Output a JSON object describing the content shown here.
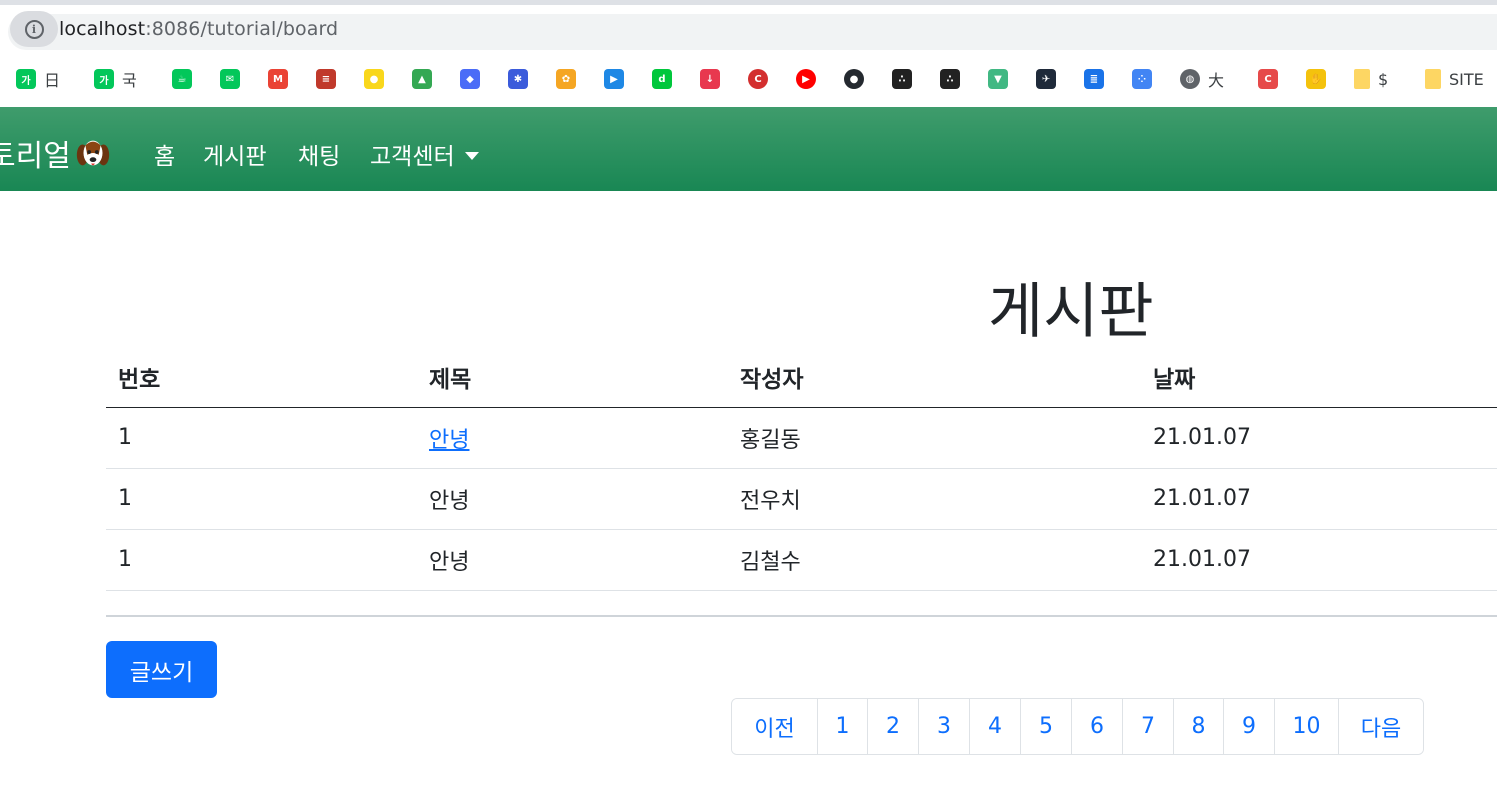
{
  "browser": {
    "url_host": "localhost",
    "url_path": ":8086/tutorial/board",
    "bookmarks": [
      {
        "icon": "naver-dictionary-icon",
        "glyph": "가",
        "color": "#03c75a",
        "label": "日"
      },
      {
        "icon": "naver-dictionary-icon",
        "glyph": "가",
        "color": "#03c75a",
        "label": "국"
      },
      {
        "icon": "naver-cafe-icon",
        "glyph": "☕",
        "color": "#03c75a",
        "label": ""
      },
      {
        "icon": "naver-mail-icon",
        "glyph": "✉",
        "color": "#03c75a",
        "label": ""
      },
      {
        "icon": "gmail-icon",
        "glyph": "M",
        "color": "#ea4335",
        "label": ""
      },
      {
        "icon": "rainbow-icon",
        "glyph": "≡",
        "color": "#c0392b",
        "label": ""
      },
      {
        "icon": "map-pin-icon",
        "glyph": "●",
        "color": "#f9d71c",
        "label": ""
      },
      {
        "icon": "google-drive-icon",
        "glyph": "▲",
        "color": "#34a853",
        "label": ""
      },
      {
        "icon": "cube-icon",
        "glyph": "◆",
        "color": "#4a6cf7",
        "label": ""
      },
      {
        "icon": "tool-icon",
        "glyph": "✱",
        "color": "#3b5bdb",
        "label": ""
      },
      {
        "icon": "gift-icon",
        "glyph": "✿",
        "color": "#f5a623",
        "label": ""
      },
      {
        "icon": "play-icon",
        "glyph": "▶",
        "color": "#1e88e5",
        "label": ""
      },
      {
        "icon": "d-icon",
        "glyph": "d",
        "color": "#00c73c",
        "label": ""
      },
      {
        "icon": "download-icon",
        "glyph": "↓",
        "color": "#e8384f",
        "label": ""
      },
      {
        "icon": "c-badge-icon",
        "glyph": "C",
        "color": "#d32f2f",
        "label": ""
      },
      {
        "icon": "youtube-icon",
        "glyph": "▶",
        "color": "#ff0000",
        "label": ""
      },
      {
        "icon": "github-icon",
        "glyph": "●",
        "color": "#24292f",
        "label": ""
      },
      {
        "icon": "dots-icon",
        "glyph": "∴",
        "color": "#222222",
        "label": ""
      },
      {
        "icon": "dots-icon",
        "glyph": "∴",
        "color": "#222222",
        "label": ""
      },
      {
        "icon": "vue-icon",
        "glyph": "▼",
        "color": "#41b883",
        "label": ""
      },
      {
        "icon": "bird-icon",
        "glyph": "✈",
        "color": "#1f2a3a",
        "label": ""
      },
      {
        "icon": "list-icon",
        "glyph": "≣",
        "color": "#1a73e8",
        "label": ""
      },
      {
        "icon": "apps-icon",
        "glyph": "⁘",
        "color": "#4285f4",
        "label": ""
      },
      {
        "icon": "globe-icon",
        "glyph": "◍",
        "color": "#5f6368",
        "label": "大"
      },
      {
        "icon": "c-square-icon",
        "glyph": "C",
        "color": "#e64a4a",
        "label": ""
      },
      {
        "icon": "hand-icon",
        "glyph": "✋",
        "color": "#f4c20d",
        "label": ""
      },
      {
        "icon": "folder-icon",
        "glyph": "",
        "color": "#fdd663",
        "label": "$"
      },
      {
        "icon": "folder-icon",
        "glyph": "",
        "color": "#fdd663",
        "label": "SITE"
      }
    ]
  },
  "navbar": {
    "brand": "토리얼",
    "items": [
      "홈",
      "게시판",
      "채팅",
      "고객센터"
    ]
  },
  "page": {
    "title": "게시판"
  },
  "table": {
    "headers": [
      "번호",
      "제목",
      "작성자",
      "날짜"
    ],
    "rows": [
      {
        "num": "1",
        "title": "안녕",
        "author": "홍길동",
        "date": "21.01.07"
      },
      {
        "num": "1",
        "title": "안녕",
        "author": "전우치",
        "date": "21.01.07"
      },
      {
        "num": "1",
        "title": "안녕",
        "author": "김철수",
        "date": "21.01.07"
      }
    ]
  },
  "actions": {
    "write_label": "글쓰기"
  },
  "pagination": {
    "prev": "이전",
    "pages": [
      "1",
      "2",
      "3",
      "4",
      "5",
      "6",
      "7",
      "8",
      "9",
      "10"
    ],
    "next": "다음"
  }
}
